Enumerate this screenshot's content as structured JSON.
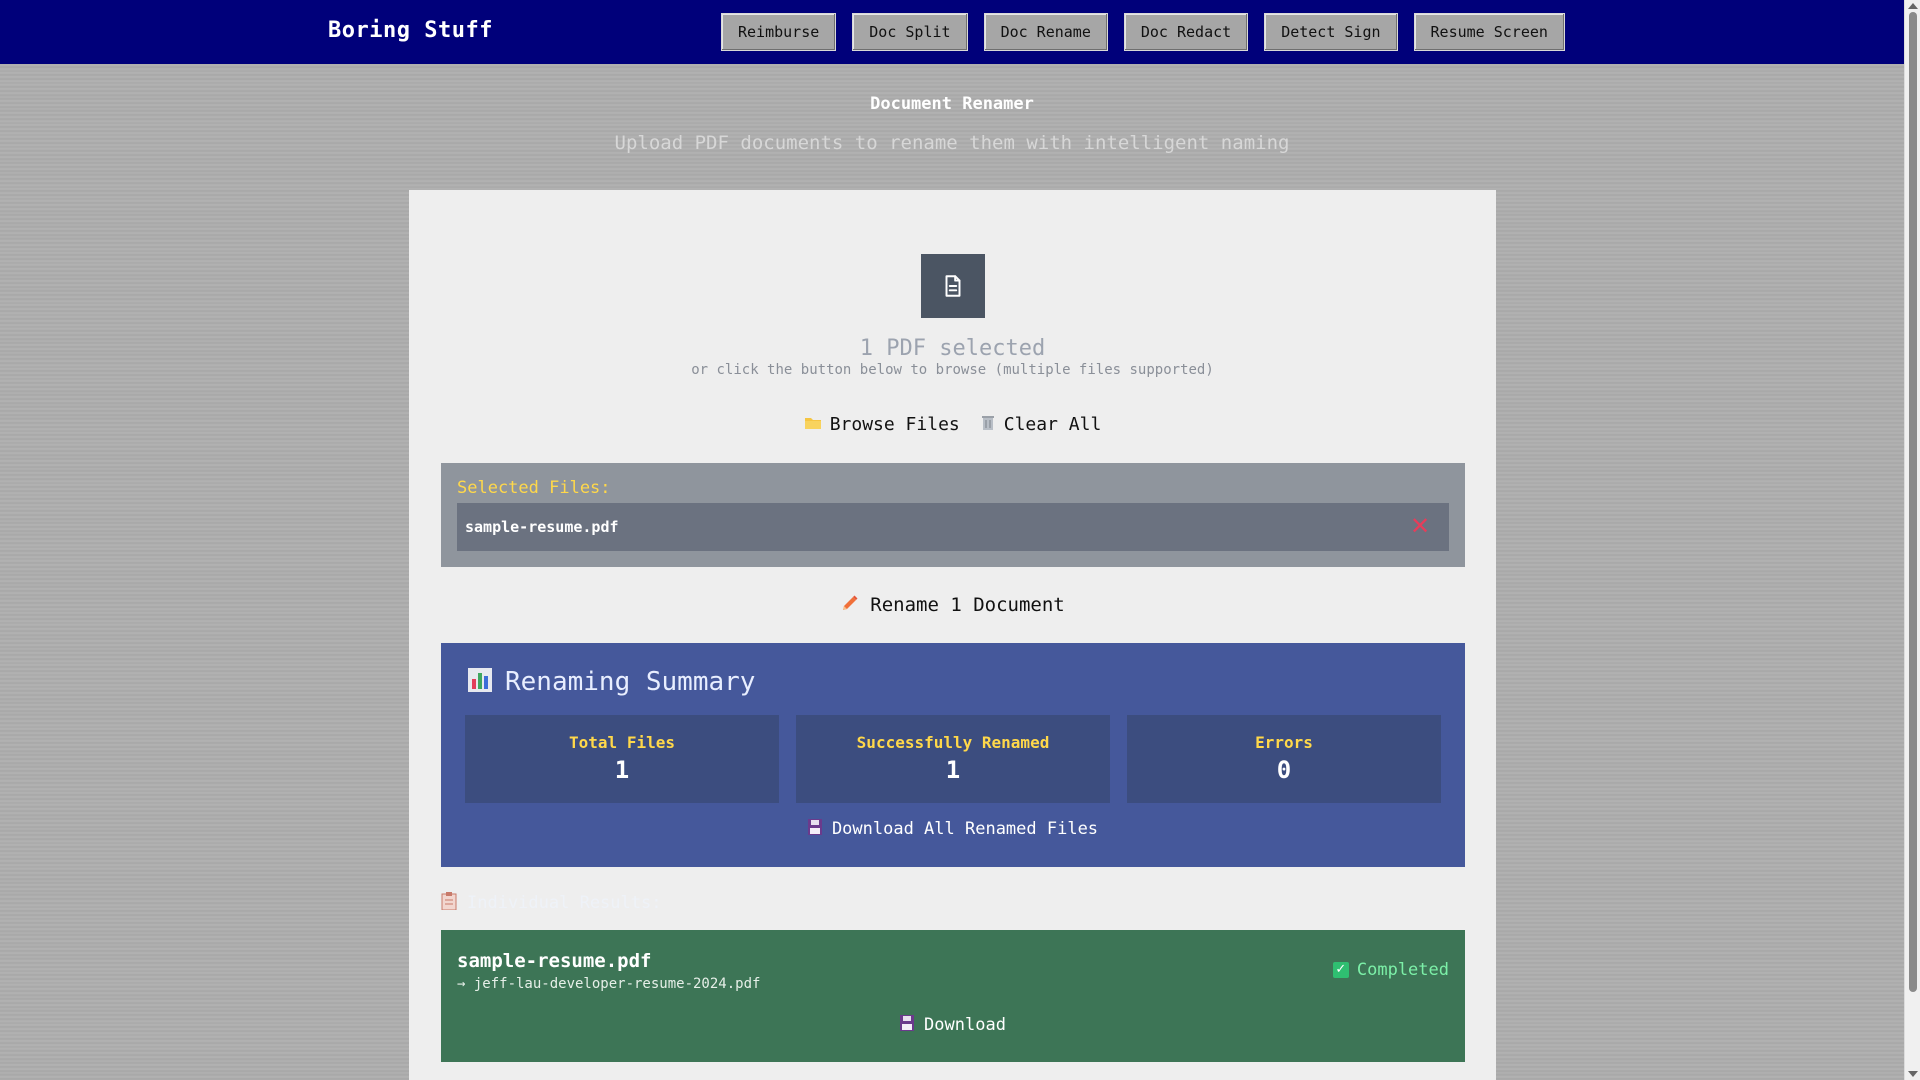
{
  "header": {
    "brand": "Boring Stuff",
    "nav": [
      "Reimburse",
      "Doc Split",
      "Doc Rename",
      "Doc Redact",
      "Detect Sign",
      "Resume Screen"
    ],
    "background_color": "#00007a"
  },
  "page": {
    "title": "Document Renamer",
    "subtitle": "Upload PDF documents to rename them with intelligent naming"
  },
  "upload": {
    "icon": "document-icon",
    "selected_count": "1 PDF selected",
    "hint": "or click the button below to browse (multiple files supported)",
    "browse_label": "Browse Files",
    "clear_label": "Clear All"
  },
  "selected_files": {
    "title": "Selected Files:",
    "files": [
      {
        "name": "sample-resume.pdf"
      }
    ]
  },
  "rename_button": {
    "label": "Rename 1 Document"
  },
  "summary": {
    "title": "Renaming Summary",
    "stats": [
      {
        "label": "Total Files",
        "value": "1"
      },
      {
        "label": "Successfully Renamed",
        "value": "1"
      },
      {
        "label": "Errors",
        "value": "0"
      }
    ],
    "download_all_label": "Download All Renamed Files",
    "background_color": "#45589b"
  },
  "results": {
    "title": "Individual Results:",
    "items": [
      {
        "original": "sample-resume.pdf",
        "renamed": "→ jeff-lau-developer-resume-2024.pdf",
        "status": "Completed",
        "download_label": "Download",
        "color": "#3d7556"
      }
    ]
  }
}
